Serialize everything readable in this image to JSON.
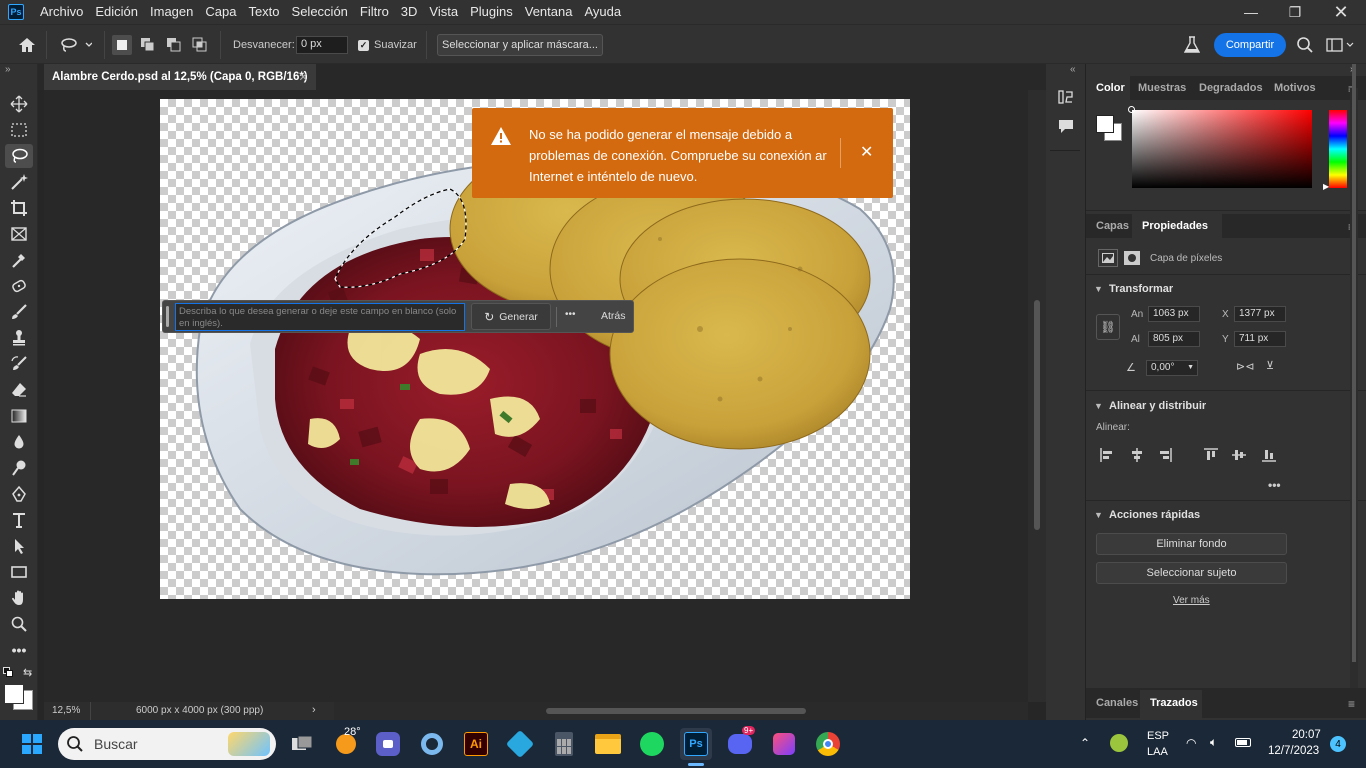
{
  "menubar": {
    "logo": "Ps",
    "items": [
      "Archivo",
      "Edición",
      "Imagen",
      "Capa",
      "Texto",
      "Selección",
      "Filtro",
      "3D",
      "Vista",
      "Plugins",
      "Ventana",
      "Ayuda"
    ]
  },
  "options": {
    "feather_label": "Desvanecer:",
    "feather_value": "0 px",
    "smooth_label": "Suavizar",
    "smooth_checked": true,
    "select_mask_button": "Seleccionar y aplicar máscara...",
    "share_button": "Compartir"
  },
  "document": {
    "tab_title": "Alambre Cerdo.psd al 12,5% (Capa 0, RGB/16*)",
    "zoom": "12,5%",
    "doc_info": "6000 px x 4000 px (300 ppp)"
  },
  "notification": {
    "message": "No se ha podido generar el mensaje debido a problemas de conexión. Compruebe su conexión ar Internet e inténtelo de nuevo."
  },
  "generative_fill": {
    "placeholder": "Describa lo que desea generar o deje este campo en blanco (solo en inglés).",
    "generate_button": "Generar",
    "more": "•••",
    "back_button": "Atrás"
  },
  "panels": {
    "color_tabs": [
      "Color",
      "Muestras",
      "Degradados",
      "Motivos"
    ],
    "properties_tabs": [
      "Capas",
      "Propiedades"
    ],
    "layer_type": "Capa de píxeles",
    "transform": {
      "title": "Transformar",
      "w_label": "An",
      "w_value": "1063 px",
      "h_label": "Al",
      "h_value": "805 px",
      "x_label": "X",
      "x_value": "1377 px",
      "y_label": "Y",
      "y_value": "711 px",
      "angle_value": "0,00°"
    },
    "align": {
      "title": "Alinear y distribuir",
      "label": "Alinear:"
    },
    "quick_actions": {
      "title": "Acciones rápidas",
      "remove_bg": "Eliminar fondo",
      "select_subject": "Seleccionar sujeto",
      "see_more": "Ver más"
    },
    "bottom_tabs": [
      "Canales",
      "Trazados"
    ]
  },
  "taskbar": {
    "search_placeholder": "Buscar",
    "weather": "28°",
    "discord_badge": "9+",
    "language_line1": "ESP",
    "language_line2": "LAA",
    "time": "20:07",
    "date": "12/7/2023",
    "notification_count": "4"
  },
  "colors": {
    "accent_blue": "#1473e6",
    "warning_orange": "#d36a0f",
    "panel_bg": "#323232"
  }
}
